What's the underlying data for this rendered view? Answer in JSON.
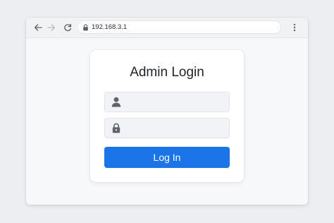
{
  "browser": {
    "url": "192.168.3.1",
    "icons": {
      "back": "arrow-left-icon",
      "forward": "arrow-right-icon",
      "reload": "reload-icon",
      "secure": "lock-icon",
      "menu": "kebab-menu-icon"
    }
  },
  "login": {
    "title": "Admin Login",
    "username": {
      "value": "",
      "placeholder": "",
      "icon": "user-icon"
    },
    "password": {
      "value": "",
      "placeholder": "",
      "icon": "padlock-icon"
    },
    "submit_label": "Log In"
  },
  "colors": {
    "accent": "#1b74e8",
    "field_bg": "#f1f3f6",
    "page_bg": "#eceef1"
  }
}
